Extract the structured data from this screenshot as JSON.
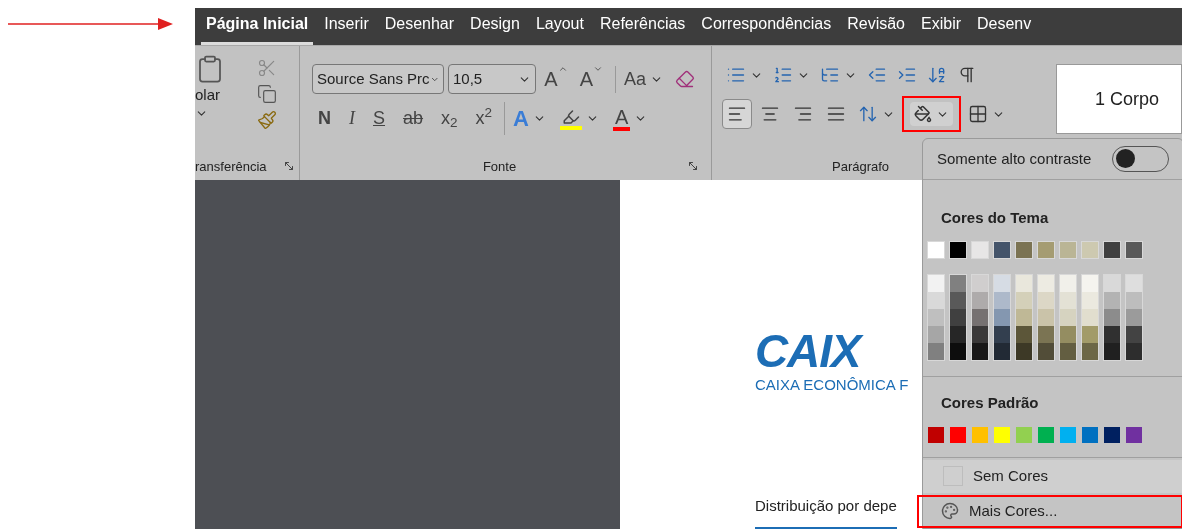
{
  "tabs": [
    {
      "label": "Página Inicial",
      "selected": true
    },
    {
      "label": "Inserir",
      "selected": false
    },
    {
      "label": "Desenhar",
      "selected": false
    },
    {
      "label": "Design",
      "selected": false
    },
    {
      "label": "Layout",
      "selected": false
    },
    {
      "label": "Referências",
      "selected": false
    },
    {
      "label": "Correspondências",
      "selected": false
    },
    {
      "label": "Revisão",
      "selected": false
    },
    {
      "label": "Exibir",
      "selected": false
    },
    {
      "label": "Desenv",
      "selected": false
    }
  ],
  "ribbon": {
    "clipboard": {
      "paste_label": "olar",
      "group_label": "ransferência"
    },
    "font": {
      "font_name": "Source Sans Prc",
      "font_size": "10,5",
      "grow_label": "A",
      "shrink_label": "A",
      "case_label": "Aa",
      "format_buttons": [
        {
          "label": "N",
          "kind": "bold"
        },
        {
          "label": "I",
          "kind": "italic"
        },
        {
          "label": "S",
          "kind": "underline"
        },
        {
          "label": "ab",
          "kind": "strike"
        },
        {
          "label": "x$_{2}$",
          "kind": "script"
        },
        {
          "label": "x$^{2}$",
          "kind": "script"
        }
      ],
      "effects_label": "A",
      "color_label": "A",
      "group_label": "Fonte"
    },
    "paragraph": {
      "alignments": [
        {
          "kind": "left",
          "selected": true
        },
        {
          "kind": "center",
          "selected": false
        },
        {
          "kind": "right",
          "selected": false
        },
        {
          "kind": "justify",
          "selected": false
        }
      ],
      "shading_highlighted": true,
      "group_label": "Parágrafo"
    },
    "styles": {
      "style_name": "1 Corpo"
    }
  },
  "shading_menu": {
    "high_contrast": {
      "label": "Somente alto contraste",
      "on": false
    },
    "theme_title": "Cores do Tema",
    "theme_colors": [
      {
        "color": "#ffffff"
      },
      {
        "color": "#000000"
      },
      {
        "color": "#e7e6e6"
      },
      {
        "color": "#44546a"
      },
      {
        "color": "#7b7353"
      },
      {
        "color": "#a59c72"
      },
      {
        "color": "#bab595"
      },
      {
        "color": "#cdc9b0"
      },
      {
        "color": "#404040"
      },
      {
        "color": "#595959"
      }
    ],
    "theme_shades": [
      {
        "shades": [
          {
            "color": "#f2f2f2"
          },
          {
            "color": "#d9d9d9"
          },
          {
            "color": "#bfbfbf"
          },
          {
            "color": "#a6a6a6"
          },
          {
            "color": "#808080"
          }
        ]
      },
      {
        "shades": [
          {
            "color": "#808080"
          },
          {
            "color": "#595959"
          },
          {
            "color": "#404040"
          },
          {
            "color": "#262626"
          },
          {
            "color": "#0d0d0d"
          }
        ]
      },
      {
        "shades": [
          {
            "color": "#d0cece"
          },
          {
            "color": "#aeabab"
          },
          {
            "color": "#767171"
          },
          {
            "color": "#3a3838"
          },
          {
            "color": "#181717"
          }
        ]
      },
      {
        "shades": [
          {
            "color": "#d6dce4"
          },
          {
            "color": "#adb9ca"
          },
          {
            "color": "#8497b0"
          },
          {
            "color": "#333f4f"
          },
          {
            "color": "#222a35"
          }
        ]
      },
      {
        "shades": [
          {
            "color": "#e9e7dc"
          },
          {
            "color": "#d4d0b9"
          },
          {
            "color": "#bfb896"
          },
          {
            "color": "#5c5639"
          },
          {
            "color": "#3d3926"
          }
        ]
      },
      {
        "shades": [
          {
            "color": "#edebe2"
          },
          {
            "color": "#dcd7c6"
          },
          {
            "color": "#cac3a9"
          },
          {
            "color": "#7b7453"
          },
          {
            "color": "#524d38"
          }
        ]
      },
      {
        "shades": [
          {
            "color": "#f1f0ea"
          },
          {
            "color": "#e3e1d5"
          },
          {
            "color": "#d6d3c0"
          },
          {
            "color": "#948d61"
          },
          {
            "color": "#635e41"
          }
        ]
      },
      {
        "shades": [
          {
            "color": "#f5f4ef"
          },
          {
            "color": "#ebe9df"
          },
          {
            "color": "#e1dece"
          },
          {
            "color": "#a29b69"
          },
          {
            "color": "#6c6746"
          }
        ]
      },
      {
        "shades": [
          {
            "color": "#d9d9d9"
          },
          {
            "color": "#b3b3b3"
          },
          {
            "color": "#8c8c8c"
          },
          {
            "color": "#303030"
          },
          {
            "color": "#202020"
          }
        ]
      },
      {
        "shades": [
          {
            "color": "#dedede"
          },
          {
            "color": "#bdbdbd"
          },
          {
            "color": "#9b9b9b"
          },
          {
            "color": "#434343"
          },
          {
            "color": "#2d2d2d"
          }
        ]
      }
    ],
    "standard_title": "Cores Padrão",
    "standard_colors": [
      {
        "color": "#c00000"
      },
      {
        "color": "#ff0000"
      },
      {
        "color": "#ffc000"
      },
      {
        "color": "#ffff00"
      },
      {
        "color": "#92d050"
      },
      {
        "color": "#00b050"
      },
      {
        "color": "#00b0f0"
      },
      {
        "color": "#0070c0"
      },
      {
        "color": "#002060"
      },
      {
        "color": "#7030a0"
      }
    ],
    "items": [
      {
        "label": "Sem Cores",
        "kind": "none",
        "highlighted": false
      },
      {
        "label": "Mais Cores...",
        "kind": "more",
        "highlighted": true
      }
    ]
  },
  "document": {
    "logo_text": "CAIX",
    "logo_subtitle": "CAIXA ECONÔMICA F",
    "heading": "Distribuição por depe"
  }
}
